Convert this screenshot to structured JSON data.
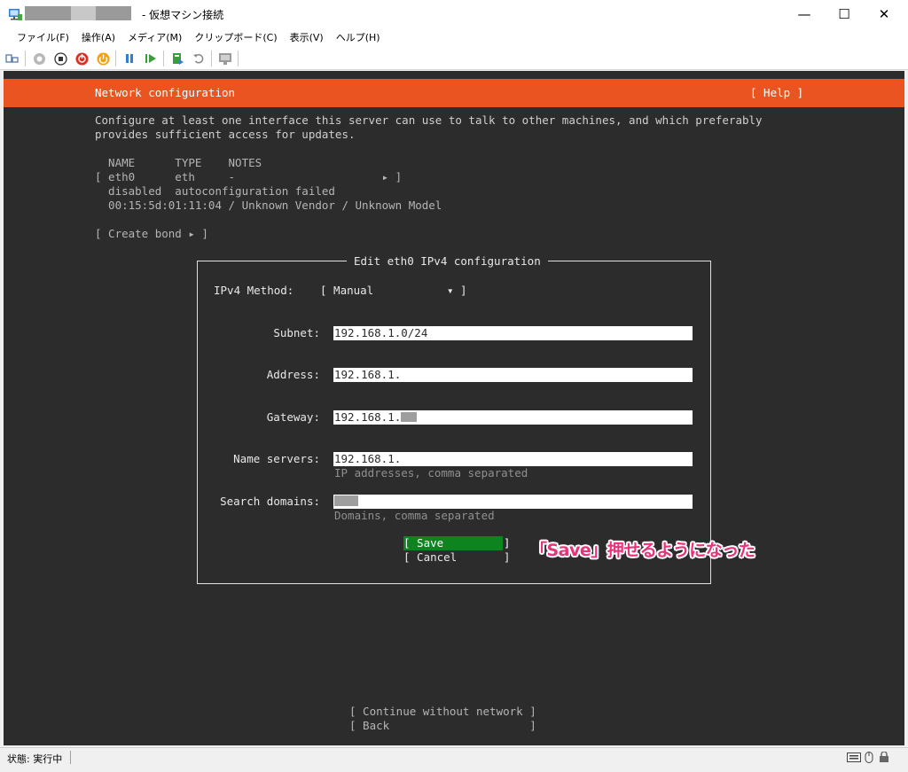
{
  "window": {
    "title": "- 仮想マシン接続",
    "minimize": "—",
    "maximize": "☐",
    "close": "✕"
  },
  "menu": [
    "ファイル(F)",
    "操作(A)",
    "メディア(M)",
    "クリップボード(C)",
    "表示(V)",
    "ヘルプ(H)"
  ],
  "colors": {
    "accent": "#e95420",
    "console_bg": "#2c2c2c",
    "save_bg": "#0e8420",
    "annotation": "#e8337a"
  },
  "installer": {
    "header_title": "Network configuration",
    "help": "[ Help ]",
    "description_line1": "Configure at least one interface this server can use to talk to other machines, and which preferably",
    "description_line2": "provides sufficient access for updates.",
    "table_header": "  NAME      TYPE    NOTES",
    "iface_row": "[ eth0      eth     -                      ▸ ]",
    "iface_status": "  disabled  autoconfiguration failed",
    "iface_hw": "  00:15:5d:01:11:04 / Unknown Vendor / Unknown Model",
    "create_bond": "[ Create bond ▸ ]",
    "continue": "[ Continue without network ]",
    "back": "[ Back                     ]"
  },
  "dialog": {
    "title": "Edit eth0 IPv4 configuration",
    "method_label": "IPv4 Method:",
    "method_value": "[ Manual           ▾ ]",
    "subnet_label": "Subnet:",
    "subnet_value": "192.168.1.0/24",
    "address_label": "Address:",
    "address_value": "192.168.1.",
    "gateway_label": "Gateway:",
    "gateway_value": "192.168.1.",
    "nameservers_label": "Name servers:",
    "nameservers_value": "192.168.1.",
    "nameservers_hint": "IP addresses, comma separated",
    "search_label": "Search domains:",
    "search_hint": "Domains, comma separated",
    "save": "[ Save         ]",
    "cancel": "[ Cancel       ]"
  },
  "annotation": "「Save」押せるようになった",
  "status": "状態: 実行中"
}
